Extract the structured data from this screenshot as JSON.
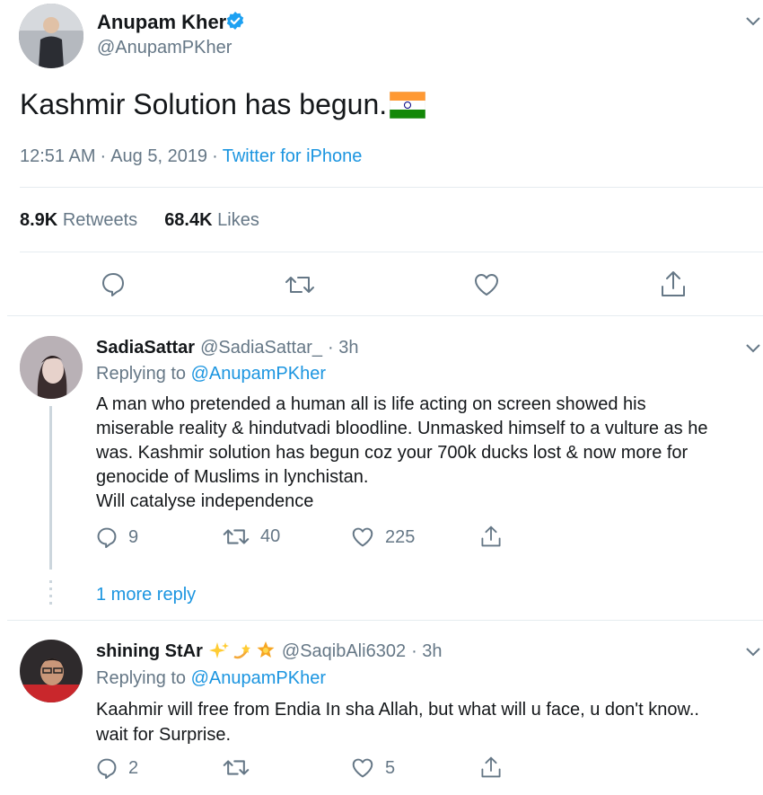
{
  "main_tweet": {
    "author_name": "Anupam Kher",
    "handle": "@AnupamPKher",
    "text": "Kashmir Solution has begun.",
    "time": "12:51 AM",
    "sep1": "·",
    "date": "Aug 5, 2019",
    "sep2": "·",
    "source": "Twitter for iPhone",
    "retweets_count": "8.9K",
    "retweets_label": "Retweets",
    "likes_count": "68.4K",
    "likes_label": "Likes"
  },
  "replies": [
    {
      "name": "SadiaSattar",
      "handle": "@SadiaSattar_",
      "time": "· 3h",
      "replying_label": "Replying to",
      "replying_to": "@AnupamPKher",
      "lines": [
        "A man who pretended a human all is life acting on screen showed his",
        "miserable reality & hindutvadi bloodline. Unmasked himself to a vulture as he",
        "was. Kashmir solution has begun coz your 700k ducks lost & now more for",
        "genocide of Muslims in lynchistan.",
        "Will catalyse independence"
      ],
      "reply_count": "9",
      "retweet_count": "40",
      "like_count": "225",
      "more_replies": "1 more reply"
    },
    {
      "name": "shining StAr",
      "handle": "@SaqibAli6302",
      "time": "· 3h",
      "replying_label": "Replying to",
      "replying_to": "@AnupamPKher",
      "lines": [
        "Kaahmir will free from Endia In sha Allah, but what will u face, u don't know..",
        "wait for Surprise."
      ],
      "reply_count": "2",
      "retweet_count": "",
      "like_count": "5"
    }
  ],
  "colors": {
    "link": "#1b95e0",
    "secondary": "#657786",
    "divider": "#e6ecf0",
    "verified": "#1da1f2"
  },
  "icons": [
    "verified-badge-icon",
    "chevron-down-icon",
    "india-flag-icon",
    "reply-icon",
    "retweet-icon",
    "like-icon",
    "share-icon",
    "sparkles-emoji",
    "dizzy-emoji",
    "star-emoji"
  ]
}
